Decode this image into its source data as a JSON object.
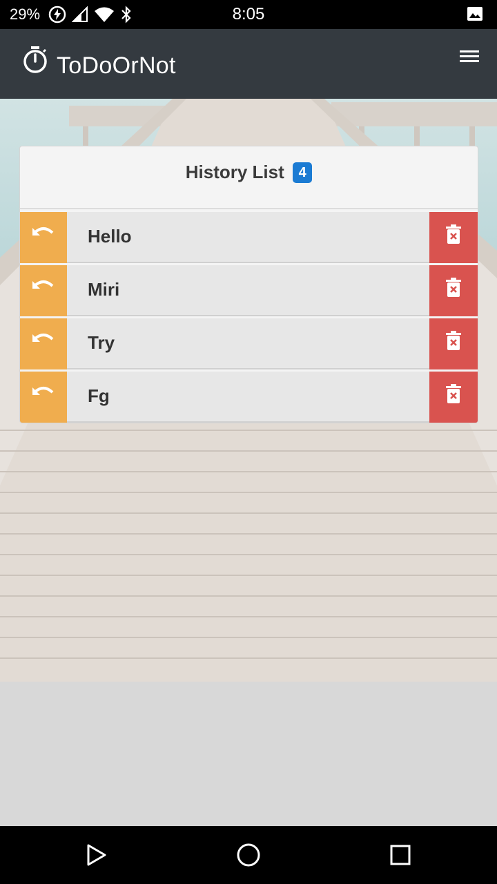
{
  "status_bar": {
    "battery": "29%",
    "time": "8:05",
    "icons": [
      "battery-saver-icon",
      "signal-icon",
      "wifi-icon",
      "bluetooth-icon",
      "image-icon"
    ]
  },
  "app_bar": {
    "title": "ToDoOrNot",
    "icon": "stopwatch-icon",
    "menu_icon": "hamburger-menu-icon"
  },
  "history": {
    "title": "History List",
    "count": "4",
    "items": [
      {
        "label": "Hello"
      },
      {
        "label": "Miri"
      },
      {
        "label": "Try"
      },
      {
        "label": "Fg"
      }
    ]
  },
  "nav_bar": {
    "icons": [
      "back-icon",
      "home-icon",
      "recents-icon"
    ]
  },
  "colors": {
    "app_bar": "#343a40",
    "undo": "#f0ad4e",
    "delete": "#d9534f",
    "badge": "#1b7bd3"
  }
}
